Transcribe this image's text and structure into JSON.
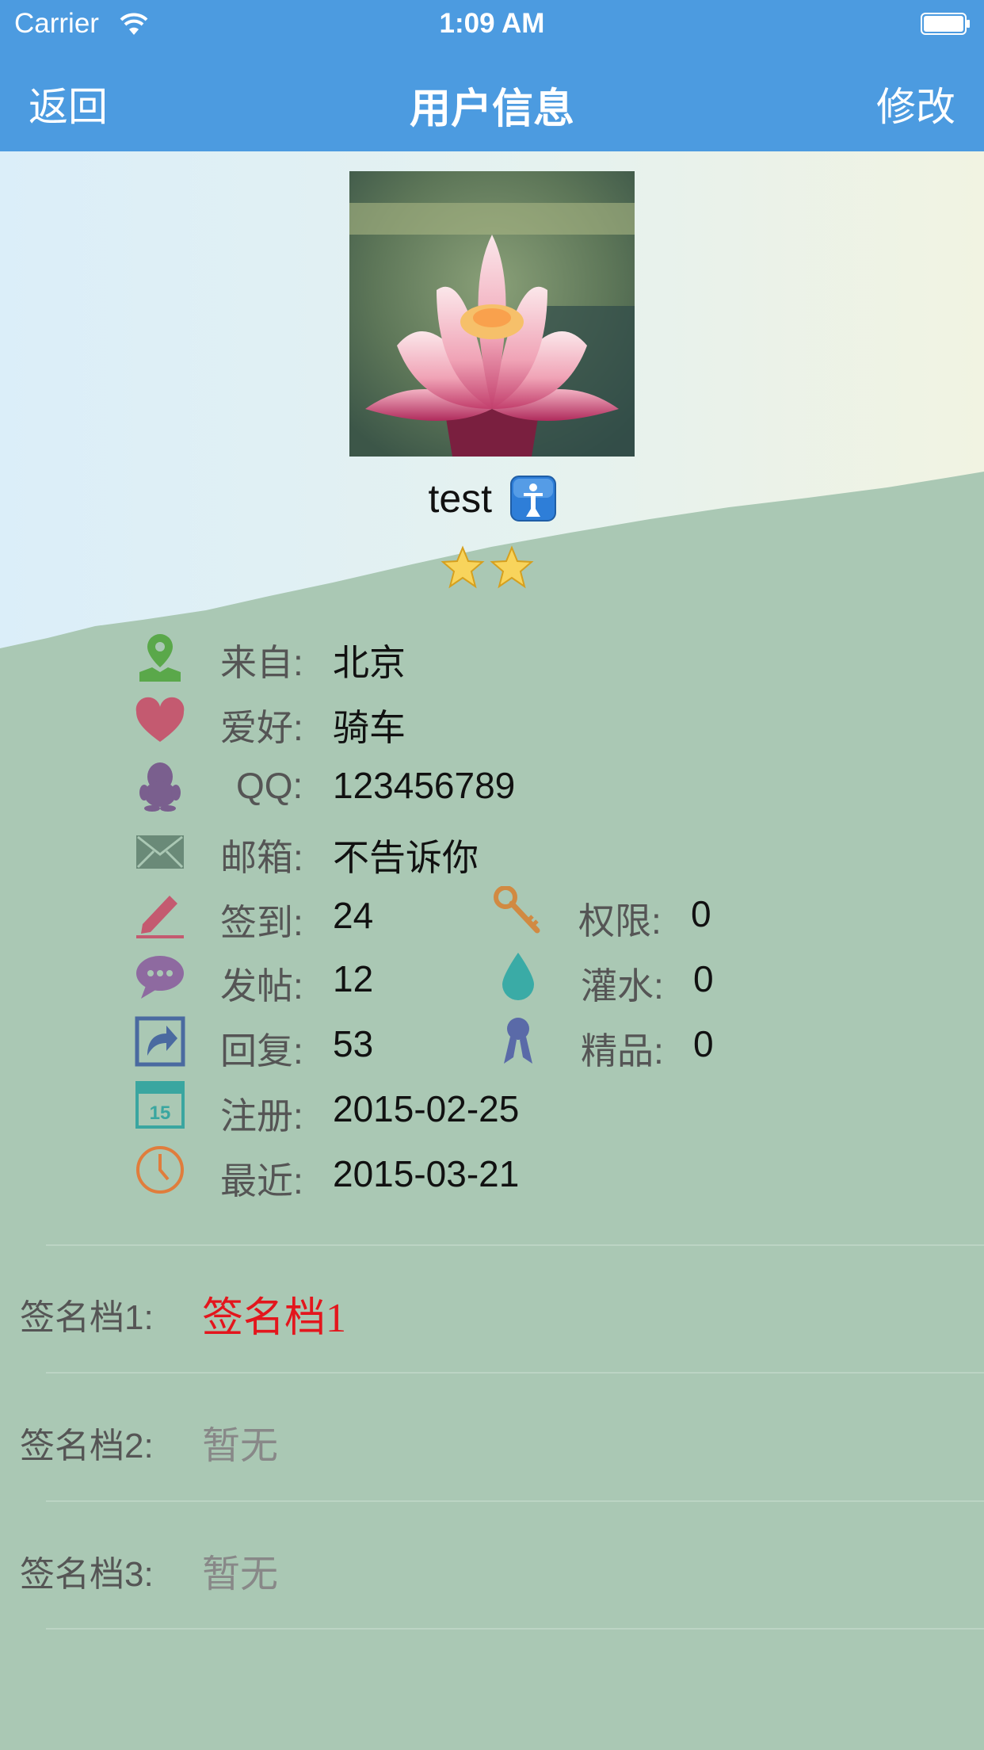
{
  "status_bar": {
    "carrier": "Carrier",
    "time": "1:09 AM"
  },
  "nav": {
    "back": "返回",
    "title": "用户信息",
    "edit": "修改"
  },
  "profile": {
    "username": "test",
    "stars": 2
  },
  "info": {
    "from_label": "来自:",
    "from_value": "北京",
    "hobby_label": "爱好:",
    "hobby_value": "骑车",
    "qq_label": "QQ:",
    "qq_value": "123456789",
    "email_label": "邮箱:",
    "email_value": "不告诉你",
    "checkin_label": "签到:",
    "checkin_value": "24",
    "perm_label": "权限:",
    "perm_value": "0",
    "posts_label": "发帖:",
    "posts_value": "12",
    "water_label": "灌水:",
    "water_value": "0",
    "replies_label": "回复:",
    "replies_value": "53",
    "elite_label": "精品:",
    "elite_value": "0",
    "register_label": "注册:",
    "register_value": "2015-02-25",
    "recent_label": "最近:",
    "recent_value": "2015-03-21"
  },
  "signatures": [
    {
      "label": "签名档1:",
      "value": "签名档1"
    },
    {
      "label": "签名档2:",
      "value": "暂无"
    },
    {
      "label": "签名档3:",
      "value": "暂无"
    }
  ],
  "colors": {
    "nav": "#4c9be0",
    "background": "#aac8b4",
    "signature_red": "#e3161d"
  },
  "icons": [
    "location-icon",
    "heart-icon",
    "qq-penguin-icon",
    "mail-icon",
    "pen-icon",
    "key-icon",
    "chat-bubble-icon",
    "water-drop-icon",
    "reply-icon",
    "ribbon-icon",
    "calendar-icon",
    "clock-icon",
    "info-icon",
    "star-icon",
    "wifi-icon",
    "battery-icon"
  ]
}
